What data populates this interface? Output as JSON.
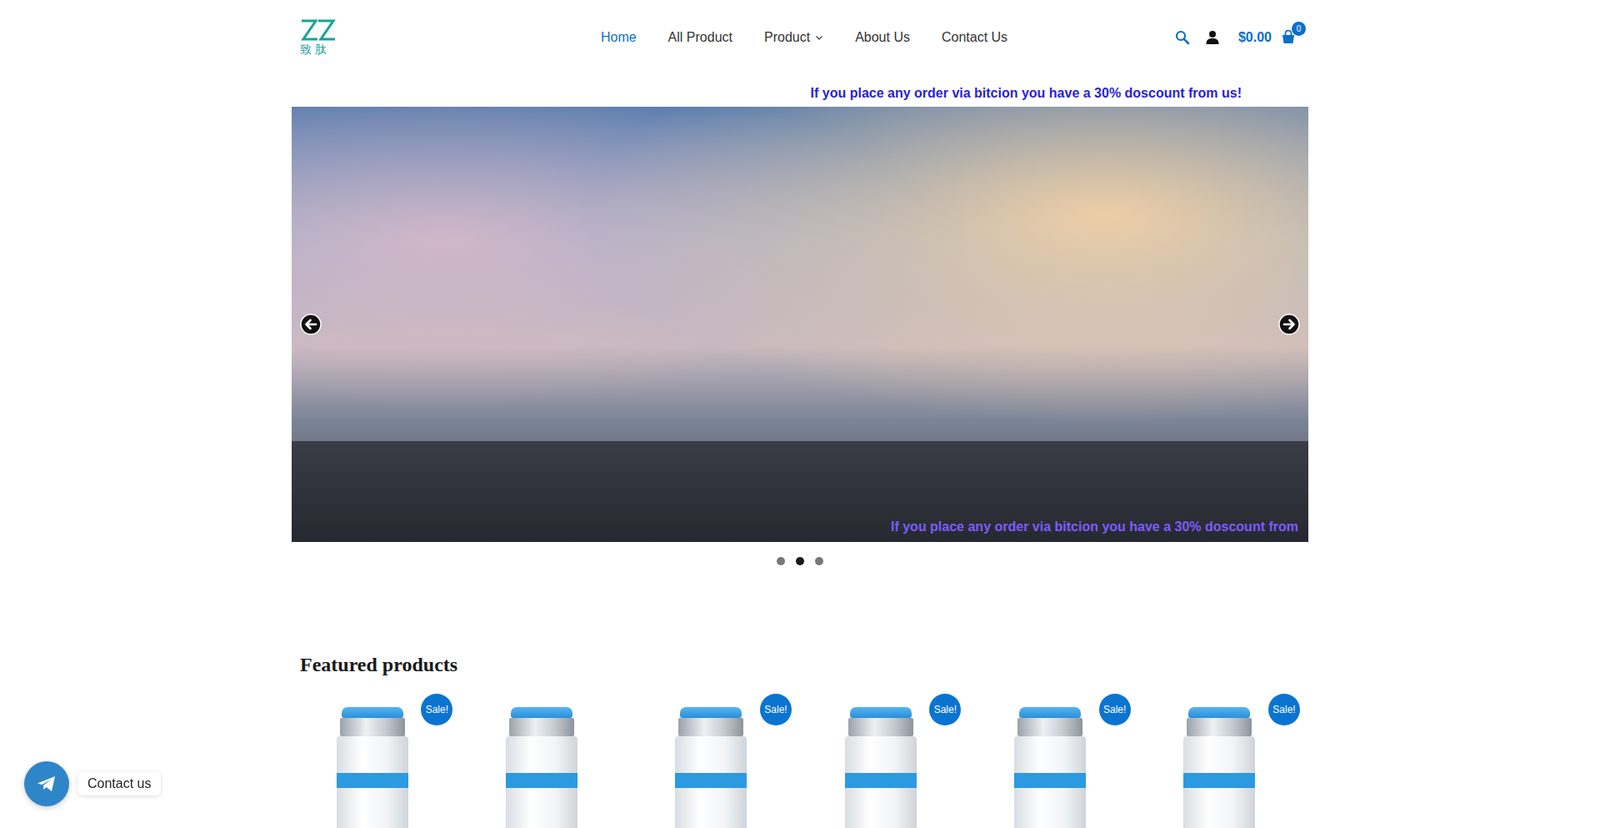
{
  "logo": {
    "text": "致肽"
  },
  "nav": [
    {
      "label": "Home",
      "selected": true,
      "dropdown": false
    },
    {
      "label": "All Product",
      "selected": false,
      "dropdown": false
    },
    {
      "label": "Product",
      "selected": false,
      "dropdown": true
    },
    {
      "label": "About Us",
      "selected": false,
      "dropdown": false
    },
    {
      "label": "Contact Us",
      "selected": false,
      "dropdown": false
    }
  ],
  "cart": {
    "total": "$0.00",
    "count": "0"
  },
  "announcement": "If you place any order via bitcion you have a 30% doscount from us!",
  "slider": {
    "caption": "If you place any order via bitcion you have a 30% doscount from",
    "dots": [
      {
        "selected": false
      },
      {
        "selected": true
      },
      {
        "selected": false
      }
    ]
  },
  "featured": {
    "title": "Featured products",
    "badge": "Sale!",
    "products": [
      {
        "sale": true
      },
      {
        "sale": false
      },
      {
        "sale": true
      },
      {
        "sale": true
      },
      {
        "sale": true
      },
      {
        "sale": true
      }
    ]
  },
  "contact": {
    "label": "Contact us"
  }
}
